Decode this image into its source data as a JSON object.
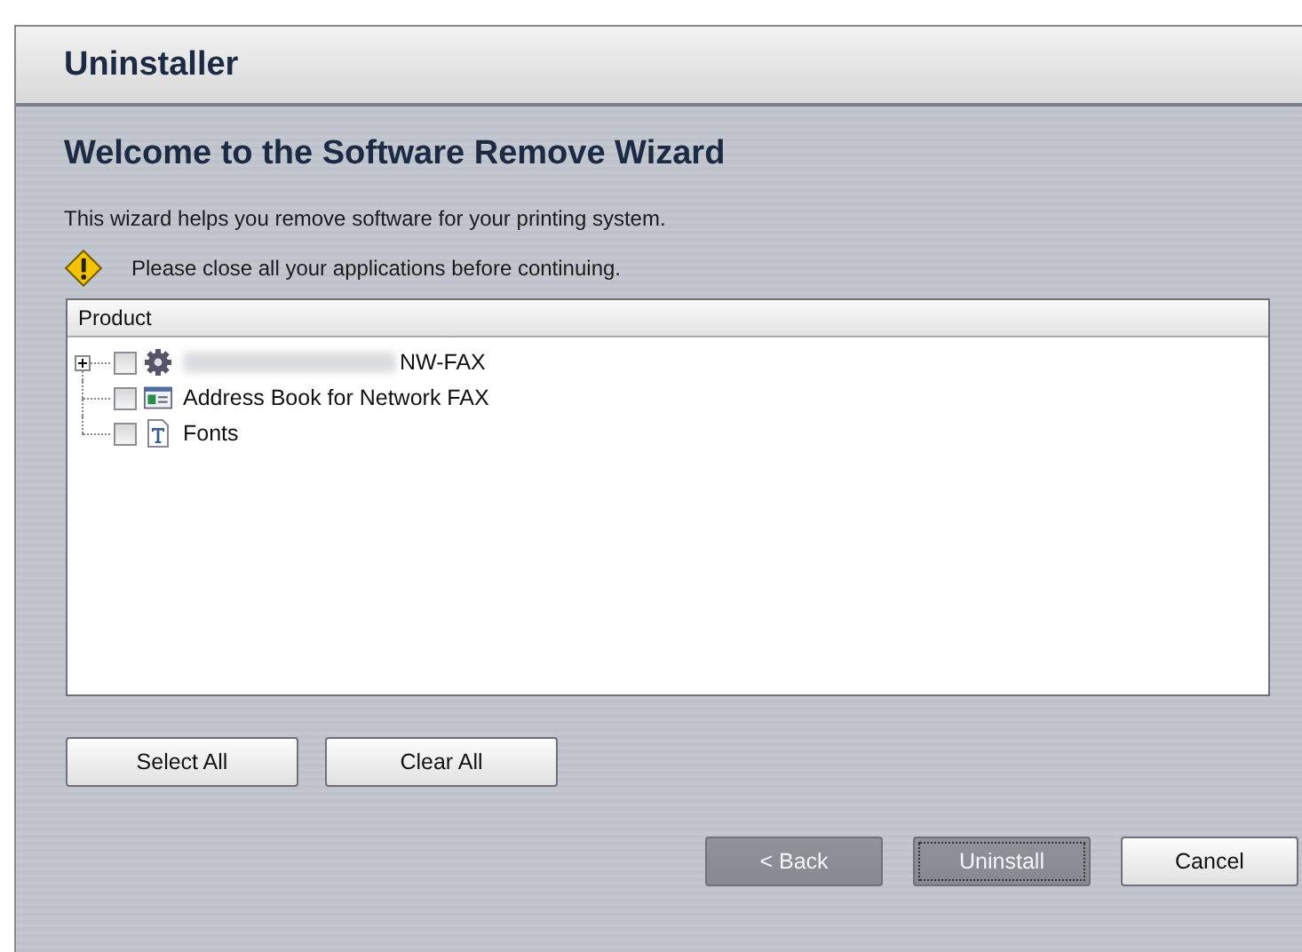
{
  "window": {
    "title": "Uninstaller"
  },
  "heading": "Welcome to the Software Remove Wizard",
  "intro": "This wizard helps you remove software for your printing system.",
  "warning": "Please close all your applications before continuing.",
  "product_list": {
    "column": "Product",
    "items": [
      {
        "kind": "gear",
        "name": "NW-FAX",
        "blurred_prefix": true,
        "expanded": false,
        "checked": false
      },
      {
        "kind": "card",
        "name": "Address Book for Network FAX",
        "checked": false
      },
      {
        "kind": "font",
        "name": "Fonts",
        "checked": false
      }
    ]
  },
  "list_buttons": [
    "Select All",
    "Clear All"
  ],
  "nav_buttons": [
    {
      "label": "< Back",
      "disabled": true,
      "focused": false
    },
    {
      "label": "Uninstall",
      "disabled": true,
      "focused": true
    },
    {
      "label": "Cancel",
      "disabled": false,
      "focused": false
    }
  ]
}
